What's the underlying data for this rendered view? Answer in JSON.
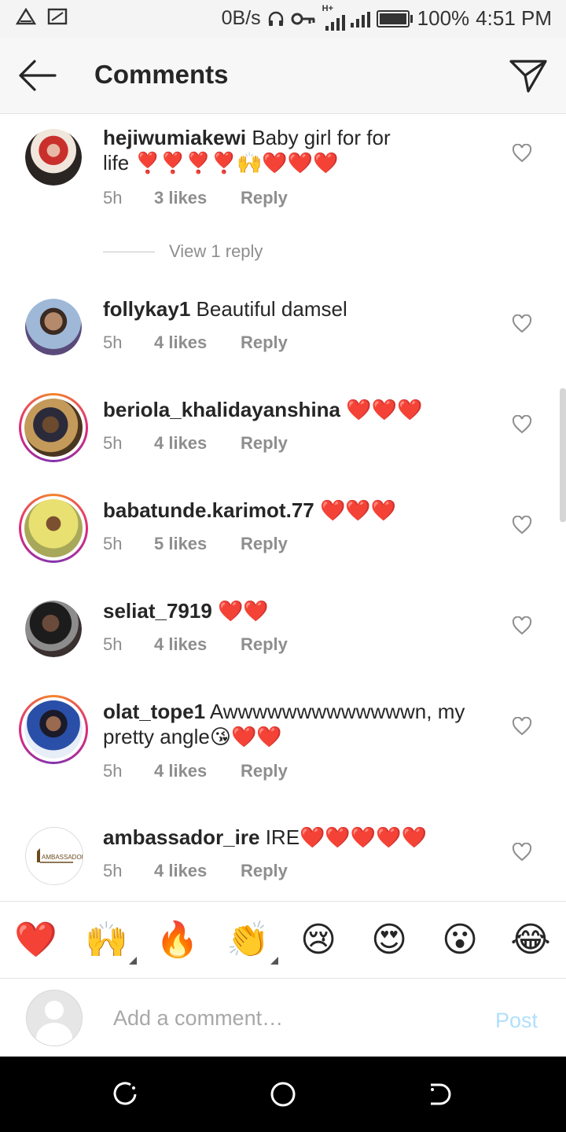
{
  "status_bar": {
    "network_speed": "0B/s",
    "network_type": "H+",
    "battery": "100%",
    "time": "4:51 PM"
  },
  "header": {
    "title": "Comments"
  },
  "comments": [
    {
      "username": "hejiwumiakewi",
      "text_line1": "Baby girl for for",
      "text_line2": "life ❣️❣️❣️❣️🙌❤️❤️❤️",
      "time": "5h",
      "likes": "3 likes",
      "reply": "Reply",
      "view_replies": "View 1 reply"
    },
    {
      "username": "follykay1",
      "text": "Beautiful damsel",
      "time": "5h",
      "likes": "4 likes",
      "reply": "Reply"
    },
    {
      "username": "beriola_khalidayanshina",
      "text": "❤️❤️❤️",
      "time": "5h",
      "likes": "4 likes",
      "reply": "Reply"
    },
    {
      "username": "babatunde.karimot.77",
      "text": "❤️❤️❤️",
      "time": "5h",
      "likes": "5 likes",
      "reply": "Reply"
    },
    {
      "username": "seliat_7919",
      "text": "❤️❤️",
      "time": "5h",
      "likes": "4 likes",
      "reply": "Reply"
    },
    {
      "username": "olat_tope1",
      "text_line1": "Awwwwwwwwwwwwwn, my",
      "text_line2": "pretty angle😘❤️❤️",
      "time": "5h",
      "likes": "4 likes",
      "reply": "Reply"
    },
    {
      "username": "ambassador_ire",
      "text": "IRE❤️❤️❤️❤️❤️",
      "time": "5h",
      "likes": "4 likes",
      "reply": "Reply",
      "avatar_logo_text": "AMBASSADOR"
    }
  ],
  "emoji_bar": {
    "emojis": [
      "❤️",
      "🙌",
      "🔥",
      "👏",
      "😢",
      "😍",
      "😮",
      "😂"
    ]
  },
  "composer": {
    "placeholder": "Add a comment…",
    "post_label": "Post"
  },
  "colors": {
    "accent_post": "#b2dffc",
    "story_ring": "#dd2a7b",
    "meta_text": "#8e8e8e"
  },
  "icons": {
    "back": "arrow-left-icon",
    "direct": "paper-plane-icon",
    "like": "heart-outline-icon"
  }
}
